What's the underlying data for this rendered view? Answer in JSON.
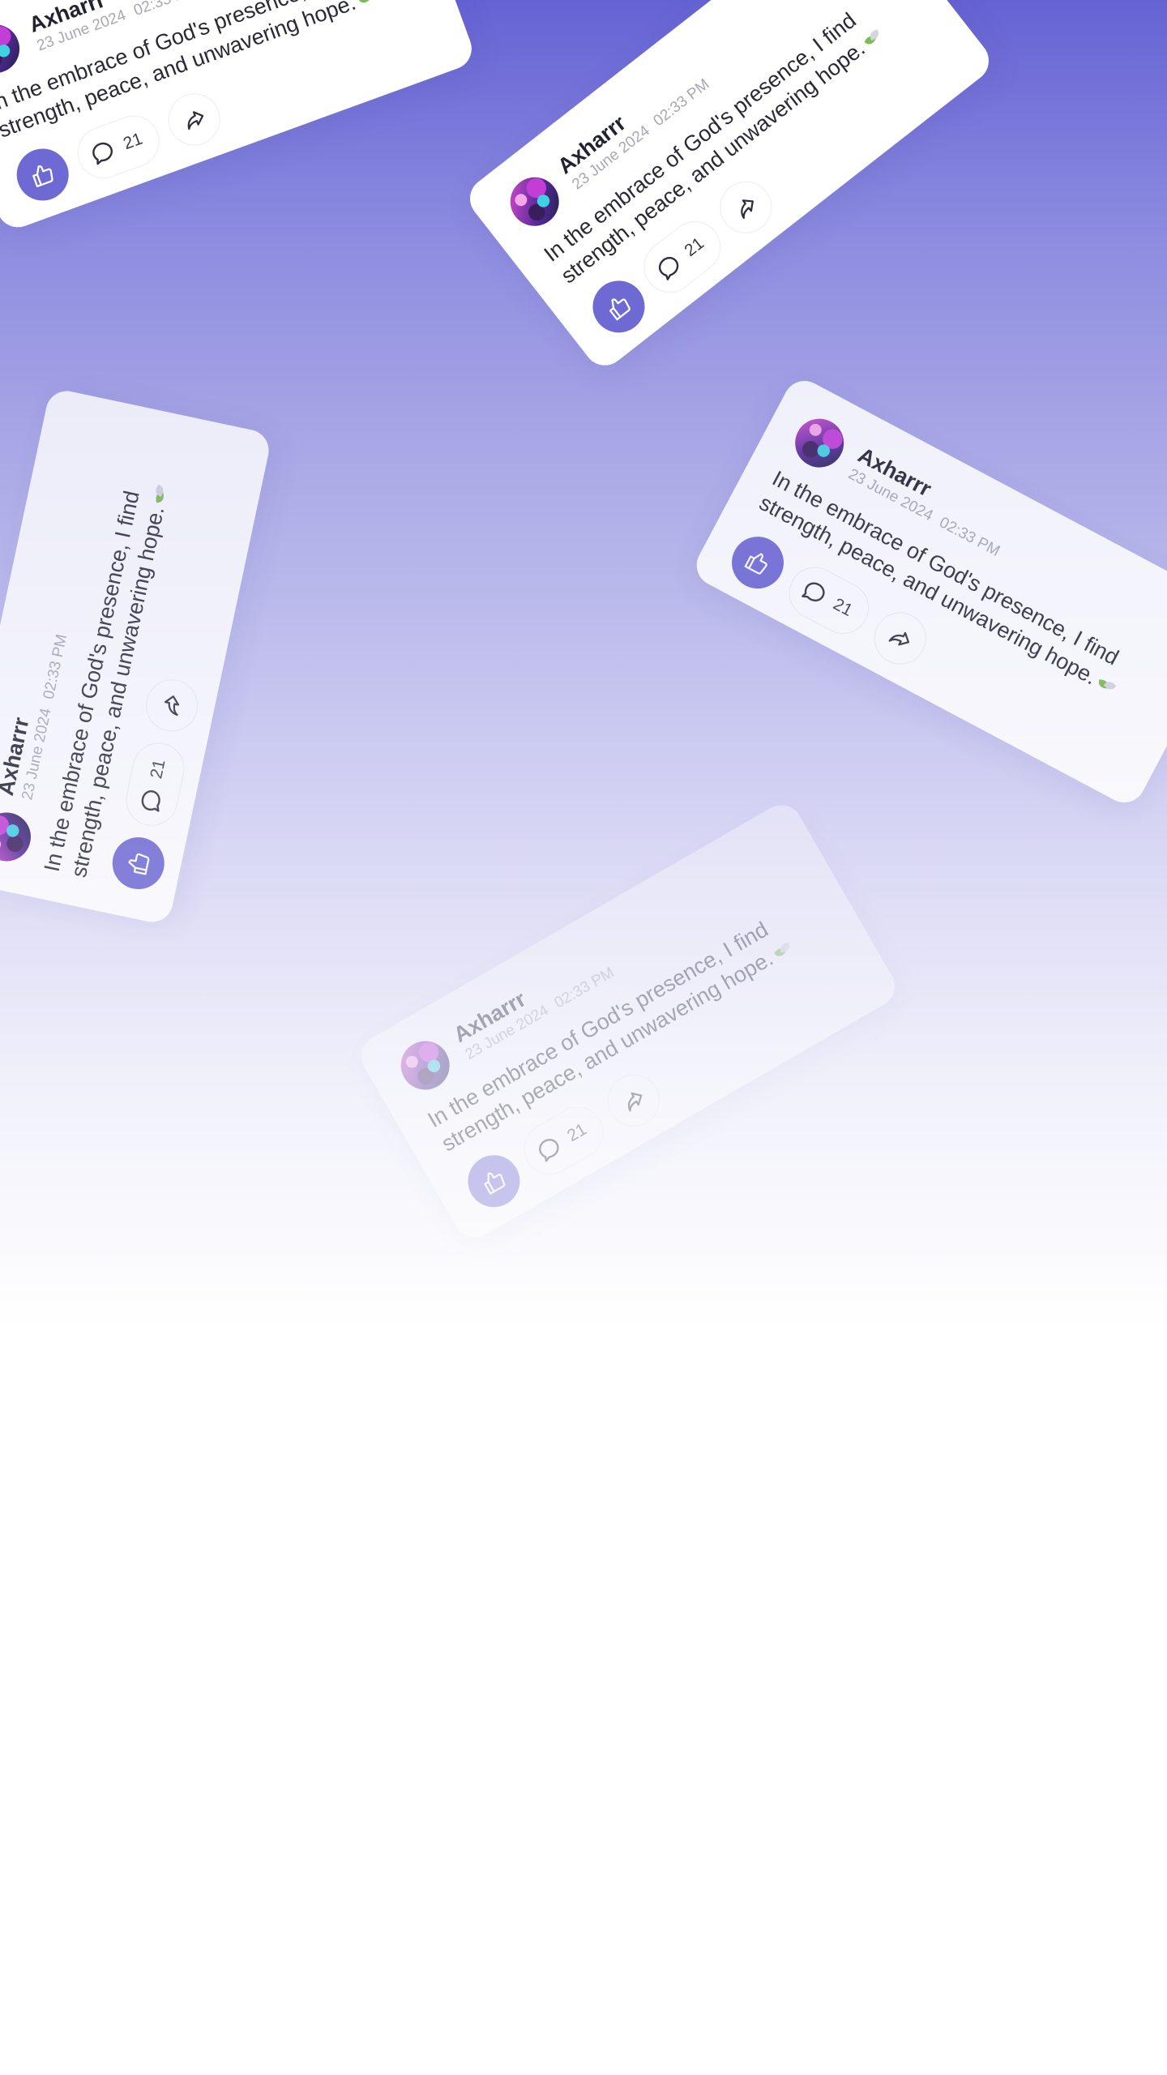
{
  "post": {
    "author": "Axharrr",
    "date": "23 June 2024",
    "time": "02:33 PM",
    "text": "In the embrace of God's presence, I find strength, peace, and unwavering hope.",
    "comment_count": "21"
  },
  "icons": {
    "like": "thumbs-up-icon",
    "comment": "speech-bubble-icon",
    "share": "share-arrow-icon",
    "emoji": "leaf-dove-icon"
  },
  "colors": {
    "gradient_top": "#6563d4",
    "gradient_bottom": "#ffffff",
    "accent": "#6f6ad3",
    "card": "#ffffff"
  }
}
